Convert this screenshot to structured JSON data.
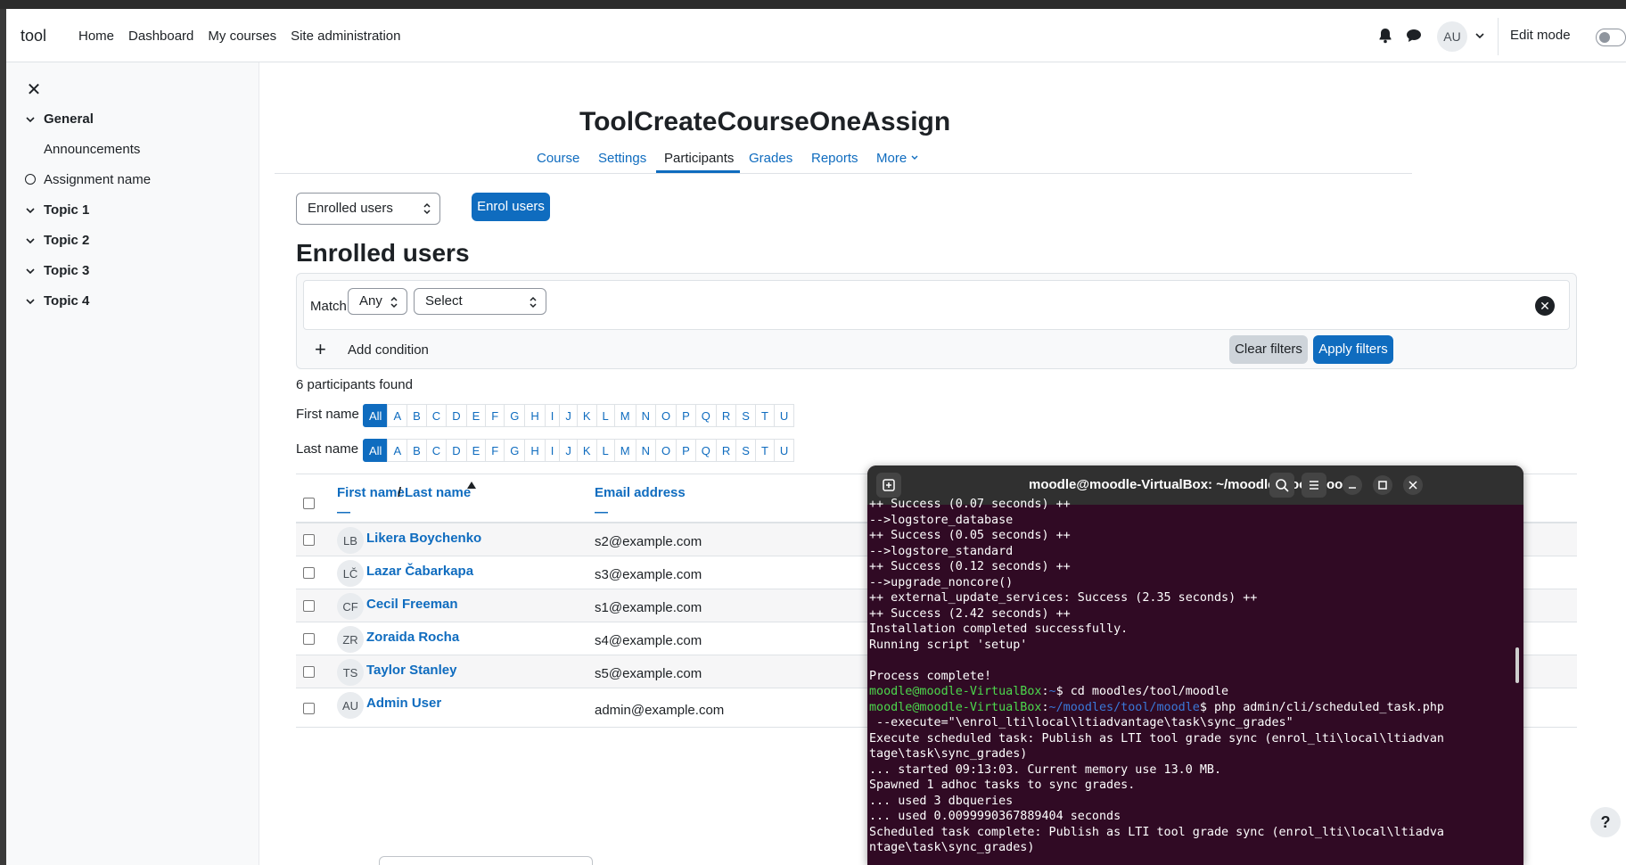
{
  "navbar": {
    "brand": "tool",
    "links": [
      "Home",
      "Dashboard",
      "My courses",
      "Site administration"
    ],
    "avatar_initials": "AU",
    "edit_mode_label": "Edit mode"
  },
  "drawer": {
    "items": [
      {
        "label": "General",
        "kind": "section"
      },
      {
        "label": "Announcements",
        "kind": "activity"
      },
      {
        "label": "Assignment name",
        "kind": "activity-circle"
      },
      {
        "label": "Topic 1",
        "kind": "section"
      },
      {
        "label": "Topic 2",
        "kind": "section"
      },
      {
        "label": "Topic 3",
        "kind": "section"
      },
      {
        "label": "Topic 4",
        "kind": "section"
      }
    ]
  },
  "course": {
    "title": "ToolCreateCourseOneAssign",
    "tabs": [
      "Course",
      "Settings",
      "Participants",
      "Grades",
      "Reports",
      "More"
    ],
    "active_tab": "Participants"
  },
  "participants": {
    "select_value": "Enrolled users",
    "enrol_button": "Enrol users",
    "heading": "Enrolled users",
    "filter": {
      "match_label": "Match",
      "match_value": "Any",
      "select_value": "Select",
      "add_condition": "Add condition",
      "clear_filters": "Clear filters",
      "apply_filters": "Apply filters"
    },
    "found_text": "6 participants found",
    "first_name_label": "First name",
    "last_name_label": "Last name",
    "initials": [
      "All",
      "A",
      "B",
      "C",
      "D",
      "E",
      "F",
      "G",
      "H",
      "I",
      "J",
      "K",
      "L",
      "M",
      "N",
      "O",
      "P",
      "Q",
      "R",
      "S",
      "T",
      "U"
    ],
    "columns": {
      "first_name": "First name",
      "separator": "/",
      "last_name": "Last name",
      "email": "Email address",
      "dash": "—"
    },
    "rows": [
      {
        "initials": "LB",
        "name": "Likera Boychenko",
        "email": "s2@example.com"
      },
      {
        "initials": "LČ",
        "name": "Lazar Čabarkapa",
        "email": "s3@example.com"
      },
      {
        "initials": "CF",
        "name": "Cecil Freeman",
        "email": "s1@example.com"
      },
      {
        "initials": "ZR",
        "name": "Zoraida Rocha",
        "email": "s4@example.com"
      },
      {
        "initials": "TS",
        "name": "Taylor Stanley",
        "email": "s5@example.com"
      },
      {
        "initials": "AU",
        "name": "Admin User",
        "email": "admin@example.com"
      }
    ]
  },
  "help_button": "?",
  "terminal": {
    "title": "moodle@moodle-VirtualBox: ~/moodles/tool/moodle",
    "lines": [
      {
        "text": "++ Success (0.07 seconds) ++"
      },
      {
        "text": "-->logstore_database"
      },
      {
        "text": "++ Success (0.05 seconds) ++"
      },
      {
        "text": "-->logstore_standard"
      },
      {
        "text": "++ Success (0.12 seconds) ++"
      },
      {
        "text": "-->upgrade_noncore()"
      },
      {
        "text": "++ external_update_services: Success (2.35 seconds) ++"
      },
      {
        "text": "++ Success (2.42 seconds) ++"
      },
      {
        "text": "Installation completed successfully."
      },
      {
        "text": "Running script 'setup'"
      },
      {
        "text": ""
      },
      {
        "text": "Process complete!"
      },
      {
        "prompt_user": "moodle@moodle-VirtualBox",
        "prompt_path": "~",
        "command": "$ cd moodles/tool/moodle"
      },
      {
        "prompt_user": "moodle@moodle-VirtualBox",
        "prompt_path": "~/moodles/tool/moodle",
        "command": "$ php admin/cli/scheduled_task.php"
      },
      {
        "text": " --execute=\"\\enrol_lti\\local\\ltiadvantage\\task\\sync_grades\""
      },
      {
        "text": "Execute scheduled task: Publish as LTI tool grade sync (enrol_lti\\local\\ltiadvan"
      },
      {
        "text": "tage\\task\\sync_grades)"
      },
      {
        "text": "... started 09:13:03. Current memory use 13.0 MB."
      },
      {
        "text": "Spawned 1 adhoc tasks to sync grades."
      },
      {
        "text": "... used 3 dbqueries"
      },
      {
        "text": "... used 0.0099990367889404 seconds"
      },
      {
        "text": "Scheduled task complete: Publish as LTI tool grade sync (enrol_lti\\local\\ltiadva"
      },
      {
        "text": "ntage\\task\\sync_grades)"
      }
    ]
  },
  "colors": {
    "link": "#0f6cbf",
    "terminal_bg": "#300a24",
    "terminal_header": "#303030",
    "prompt_green": "#4cd84c",
    "prompt_blue": "#3a78d8"
  }
}
